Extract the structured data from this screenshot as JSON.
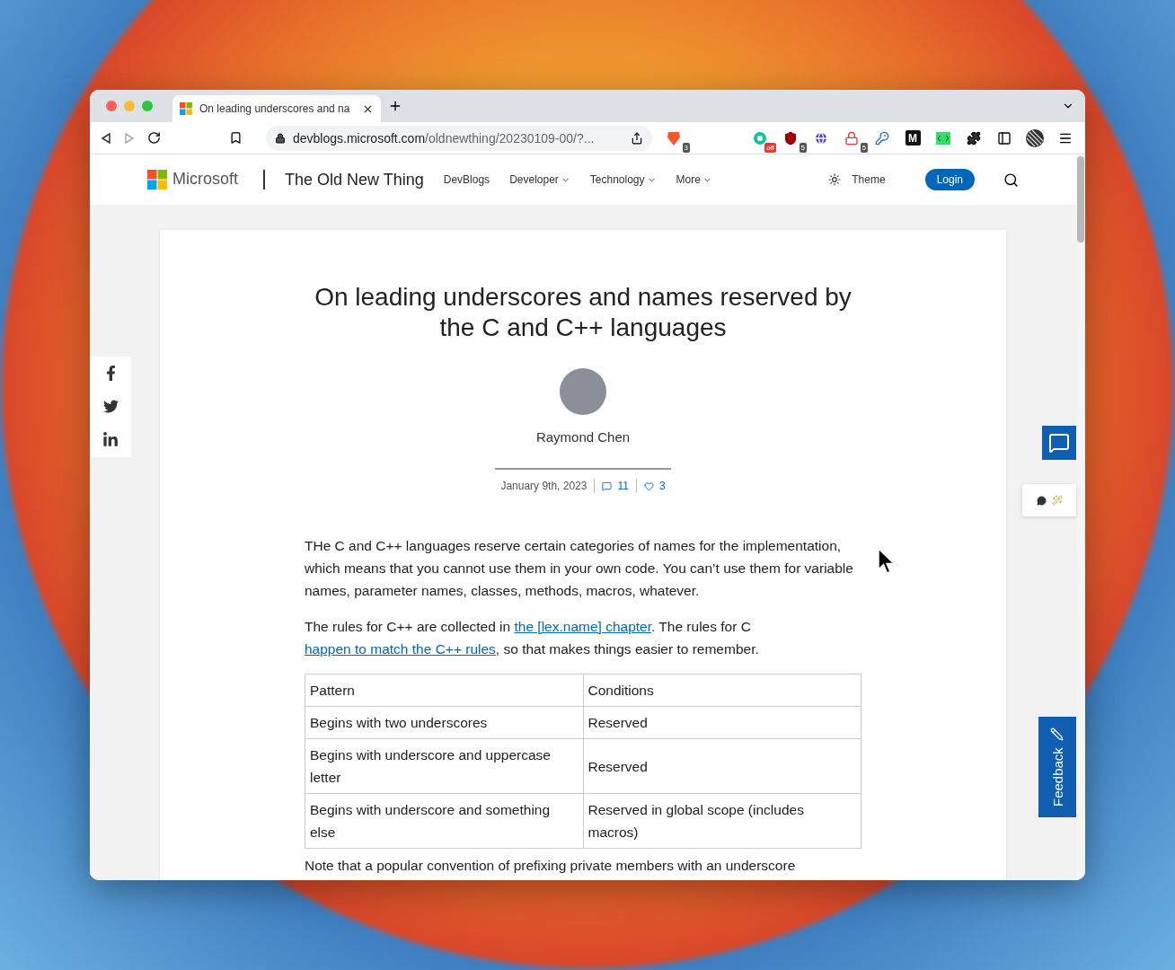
{
  "tab": {
    "title": "On leading underscores and na"
  },
  "url": {
    "host": "devblogs.microsoft.com",
    "path": "/oldnewthing/20230109-00/?..."
  },
  "brave_badge": "3",
  "extensions": [
    {
      "kind": "grammar",
      "badge": {
        "text": "off",
        "color": "#e53935"
      }
    },
    {
      "kind": "shield",
      "badge": {
        "text": "5",
        "color": "#555555"
      }
    },
    {
      "kind": "globe"
    },
    {
      "kind": "lock",
      "badge": {
        "text": "5",
        "color": "#555555"
      }
    },
    {
      "kind": "key"
    },
    {
      "kind": "letter",
      "label": "M"
    },
    {
      "kind": "code"
    },
    {
      "kind": "puzzle"
    },
    {
      "kind": "sidebar"
    },
    {
      "kind": "avatar"
    },
    {
      "kind": "menu"
    }
  ],
  "site": {
    "brand": "Microsoft",
    "blog": "The Old New Thing",
    "nav": [
      {
        "label": "DevBlogs",
        "dropdown": false
      },
      {
        "label": "Developer",
        "dropdown": true
      },
      {
        "label": "Technology",
        "dropdown": true
      },
      {
        "label": "More",
        "dropdown": true
      }
    ],
    "theme": "Theme",
    "login": "Login"
  },
  "post": {
    "title": "On leading underscores and names reserved by the C and C++ languages",
    "author": "Raymond Chen",
    "date": "January 9th, 2023",
    "comments": "11",
    "likes": "3",
    "paragraphs": [
      [
        {
          "text": "THe C and C++ languages reserve certain categories of names for the implementation, which means that you cannot use them in your own code. You can’t use them for variable names, parameter names, classes, methods, macros, whatever.",
          "link": false
        }
      ],
      [
        {
          "text": "The rules for C++ are collected in ",
          "link": false
        },
        {
          "text": "the [lex.name] chapter",
          "link": true
        },
        {
          "text": ". The rules for C ",
          "link": false
        },
        {
          "text": "happen to match the C++ rules",
          "link": true
        },
        {
          "text": ", so that makes things easier to remember.",
          "link": false
        }
      ]
    ],
    "table": {
      "columns": [
        "Pattern",
        "Conditions"
      ],
      "rows": [
        [
          "Begins with two underscores",
          "Reserved"
        ],
        [
          "Begins with underscore and uppercase letter",
          "Reserved"
        ],
        [
          "Begins with underscore and something else",
          "Reserved in global scope (includes macros)"
        ]
      ]
    },
    "after": "Note that a popular convention of prefixing private members with an underscore"
  },
  "feedback": "Feedback"
}
